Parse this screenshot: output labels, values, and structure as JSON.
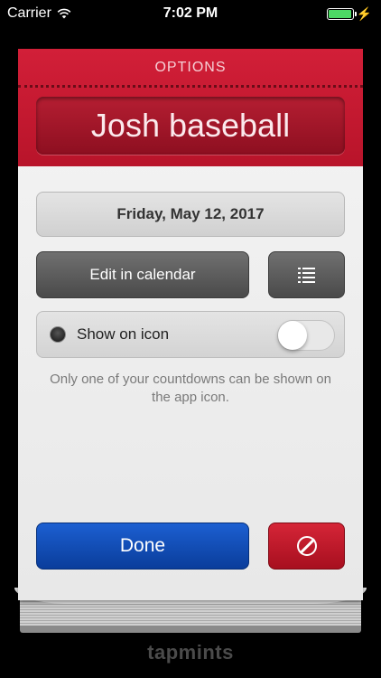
{
  "status_bar": {
    "carrier": "Carrier",
    "time": "7:02 PM",
    "battery_level": 1.0
  },
  "options": {
    "header_title": "OPTIONS",
    "countdown_name": "Josh baseball",
    "date_label": "Friday, May 12, 2017",
    "edit_calendar_label": "Edit in calendar",
    "list_icon": "list-icon",
    "show_on_icon_label": "Show on icon",
    "show_on_icon_enabled": false,
    "note": "Only one of your countdowns can be shown on the app icon.",
    "done_label": "Done",
    "cancel_icon": "no-symbol-icon"
  },
  "brand": {
    "name": "tapmints"
  },
  "colors": {
    "header_red": "#c8192f",
    "done_blue": "#1550bd",
    "cancel_red": "#c01a2c"
  }
}
